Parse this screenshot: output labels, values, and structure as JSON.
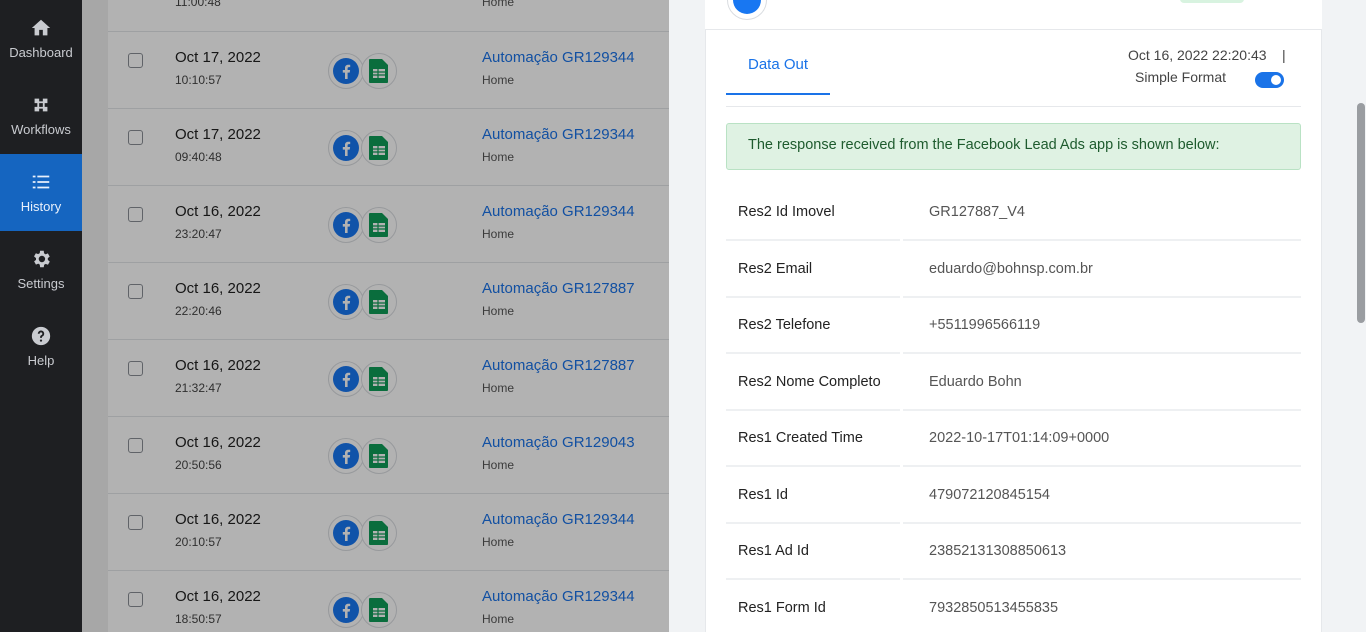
{
  "sidebar": {
    "items": [
      {
        "label": "Dashboard",
        "icon": "home-icon"
      },
      {
        "label": "Workflows",
        "icon": "workflows-icon"
      },
      {
        "label": "History",
        "icon": "history-icon",
        "active": true
      },
      {
        "label": "Settings",
        "icon": "gear-icon"
      },
      {
        "label": "Help",
        "icon": "help-icon"
      }
    ]
  },
  "history": {
    "partial_row": {
      "time": "11:00:48",
      "folder": "Home"
    },
    "rows": [
      {
        "date": "Oct 17, 2022",
        "time": "10:10:57",
        "title": "Automação GR129344",
        "folder": "Home"
      },
      {
        "date": "Oct 17, 2022",
        "time": "09:40:48",
        "title": "Automação GR129344",
        "folder": "Home"
      },
      {
        "date": "Oct 16, 2022",
        "time": "23:20:47",
        "title": "Automação GR129344",
        "folder": "Home"
      },
      {
        "date": "Oct 16, 2022",
        "time": "22:20:46",
        "title": "Automação GR127887",
        "folder": "Home"
      },
      {
        "date": "Oct 16, 2022",
        "time": "21:32:47",
        "title": "Automação GR127887",
        "folder": "Home"
      },
      {
        "date": "Oct 16, 2022",
        "time": "20:50:56",
        "title": "Automação GR129043",
        "folder": "Home"
      },
      {
        "date": "Oct 16, 2022",
        "time": "20:10:57",
        "title": "Automação GR129344",
        "folder": "Home"
      },
      {
        "date": "Oct 16, 2022",
        "time": "18:50:57",
        "title": "Automação GR129344",
        "folder": "Home"
      }
    ]
  },
  "detail": {
    "tab_label": "Data Out",
    "timestamp": "Oct 16, 2022 22:20:43",
    "separator": "|",
    "simple_format_label": "Simple Format",
    "alert": "The response received from the Facebook Lead Ads app is shown below:",
    "fields": [
      {
        "key": "Res2 Id Imovel",
        "value": "GR127887_V4"
      },
      {
        "key": "Res2 Email",
        "value": "eduardo@bohnsp.com.br"
      },
      {
        "key": "Res2 Telefone",
        "value": "+5511996566119"
      },
      {
        "key": "Res2 Nome Completo",
        "value": "Eduardo Bohn"
      },
      {
        "key": "Res1 Created Time",
        "value": "2022-10-17T01:14:09+0000"
      },
      {
        "key": "Res1 Id",
        "value": "479072120845154"
      },
      {
        "key": "Res1 Ad Id",
        "value": "23852131308850613"
      },
      {
        "key": "Res1 Form Id",
        "value": "7932850513455835"
      }
    ]
  },
  "colors": {
    "accent": "#1a73e8",
    "sidebar": "#1e1f22",
    "active": "#1565c0",
    "facebook": "#1877f2",
    "sheets": "#0f9d58"
  }
}
